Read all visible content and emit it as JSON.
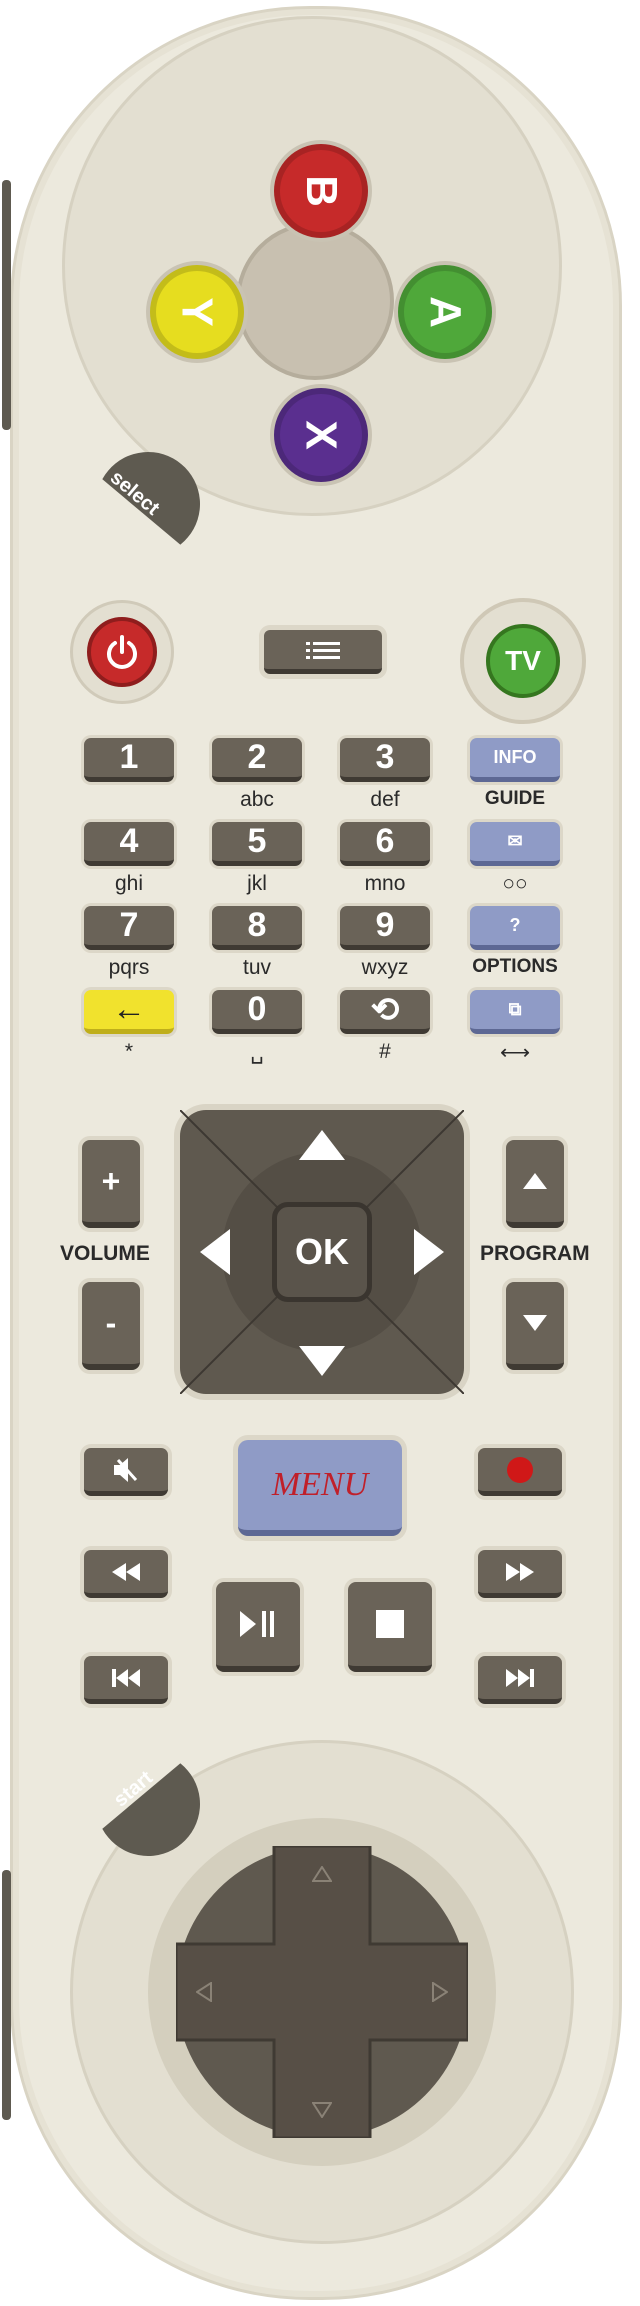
{
  "face_buttons": {
    "b": "B",
    "y": "Y",
    "a": "A",
    "x": "X"
  },
  "select_label": "select",
  "start_label": "start",
  "tv_label": "TV",
  "keypad": [
    {
      "key": "1",
      "sub": ""
    },
    {
      "key": "2",
      "sub": "abc"
    },
    {
      "key": "3",
      "sub": "def"
    },
    {
      "key": "INFO",
      "sub": "GUIDE"
    },
    {
      "key": "4",
      "sub": "ghi"
    },
    {
      "key": "5",
      "sub": "jkl"
    },
    {
      "key": "6",
      "sub": "mno"
    },
    {
      "key": "✉",
      "sub": "○○"
    },
    {
      "key": "7",
      "sub": "pqrs"
    },
    {
      "key": "8",
      "sub": "tuv"
    },
    {
      "key": "9",
      "sub": "wxyz"
    },
    {
      "key": "?",
      "sub": "OPTIONS"
    },
    {
      "key": "←",
      "sub": "*"
    },
    {
      "key": "0",
      "sub": "␣"
    },
    {
      "key": "⟲",
      "sub": "#"
    },
    {
      "key": "⧉",
      "sub": "⟷"
    }
  ],
  "volume_label": "VOLUME",
  "program_label": "PROGRAM",
  "volume_plus": "+",
  "volume_minus": "-",
  "ok_label": "OK",
  "menu_label": "MENU",
  "colors": {
    "b": "#c62a2a",
    "y": "#e6dd1f",
    "a": "#4fa83a",
    "x": "#5a2f8f",
    "power": "#c62a2a",
    "tv": "#4fa83a",
    "record": "#d01818",
    "menu_bg": "#8f9bc6",
    "menu_text": "#c0202a"
  }
}
